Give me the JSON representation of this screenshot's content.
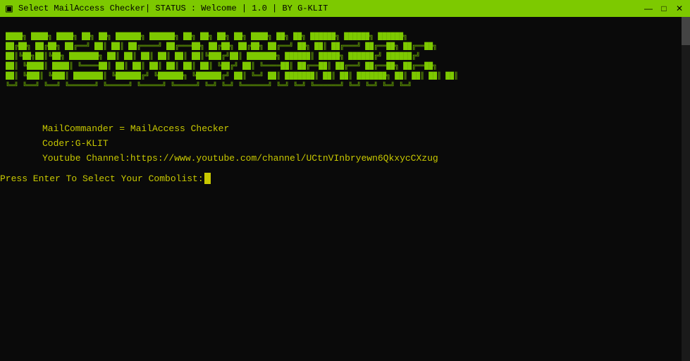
{
  "titlebar": {
    "title": "Select MailAccess Checker| STATUS : Welcome | 1.0 | BY G-KLIT",
    "icon": "▣",
    "minimize_label": "—",
    "maximize_label": "□",
    "close_label": "✕"
  },
  "ascii_art": {
    "line1": " ██╗   ██╗  █████╗  ██╗ ██╗      ██████╗ ██████╗ ███╗   ███╗███╗   ███╗ █████╗ ███╗   ██╗██████╗ ███████╗██████╗",
    "line2": " ███╗ ███║ ██╔══██╗ ██║ ██║     ██╔════╝██╔═══██╗████╗ ████║████╗ ████║██╔══██╗████╗  ██║██╔══██╗██╔════╝██╔══██╗",
    "line3": " ██╔████╔██║███████║ ██║ ██║     ██║     ██║   ██║██╔████╔██║██╔████╔██║███████║██╔██╗ ██║██║  ██║█████╗  ██████╔╝",
    "line4": " ██║╚██╔╝██║██╔══██║ ██║ ██║     ██║     ██║   ██║██║╚██╔╝██║██║╚██╔╝██║██╔══██║██║╚██╗██║██║  ██║██╔══╝  ██╔══██╗",
    "line5": " ██║ ╚═╝ ██║██║  ██║ ██║ ███████╗╚██████╗╚██████╔╝██║ ╚═╝ ██║██║ ╚═╝ ██║██║  ██║██║ ╚████║██████╔╝███████╗██║  ██║",
    "line6": " ╚═╝     ╚═╝╚═╝  ╚═╝ ╚═╝ ╚══════╝ ╚═════╝ ╚═════╝ ╚═╝     ╚═╝╚═╝     ╚═╝╚═╝  ╚═╝╚═╝  ╚═══╝╚═════╝ ╚══════╝╚═╝  ╚═╝"
  },
  "info": {
    "app_name": "MailCommander = MailAccess Checker",
    "coder": "Coder:G-KLIT",
    "youtube": "Youtube Channel:https://www.youtube.com/channel/UCtnVInbryewn6QkxycCXzug"
  },
  "prompt": {
    "text": "Press Enter To Select Your Combolist:"
  }
}
